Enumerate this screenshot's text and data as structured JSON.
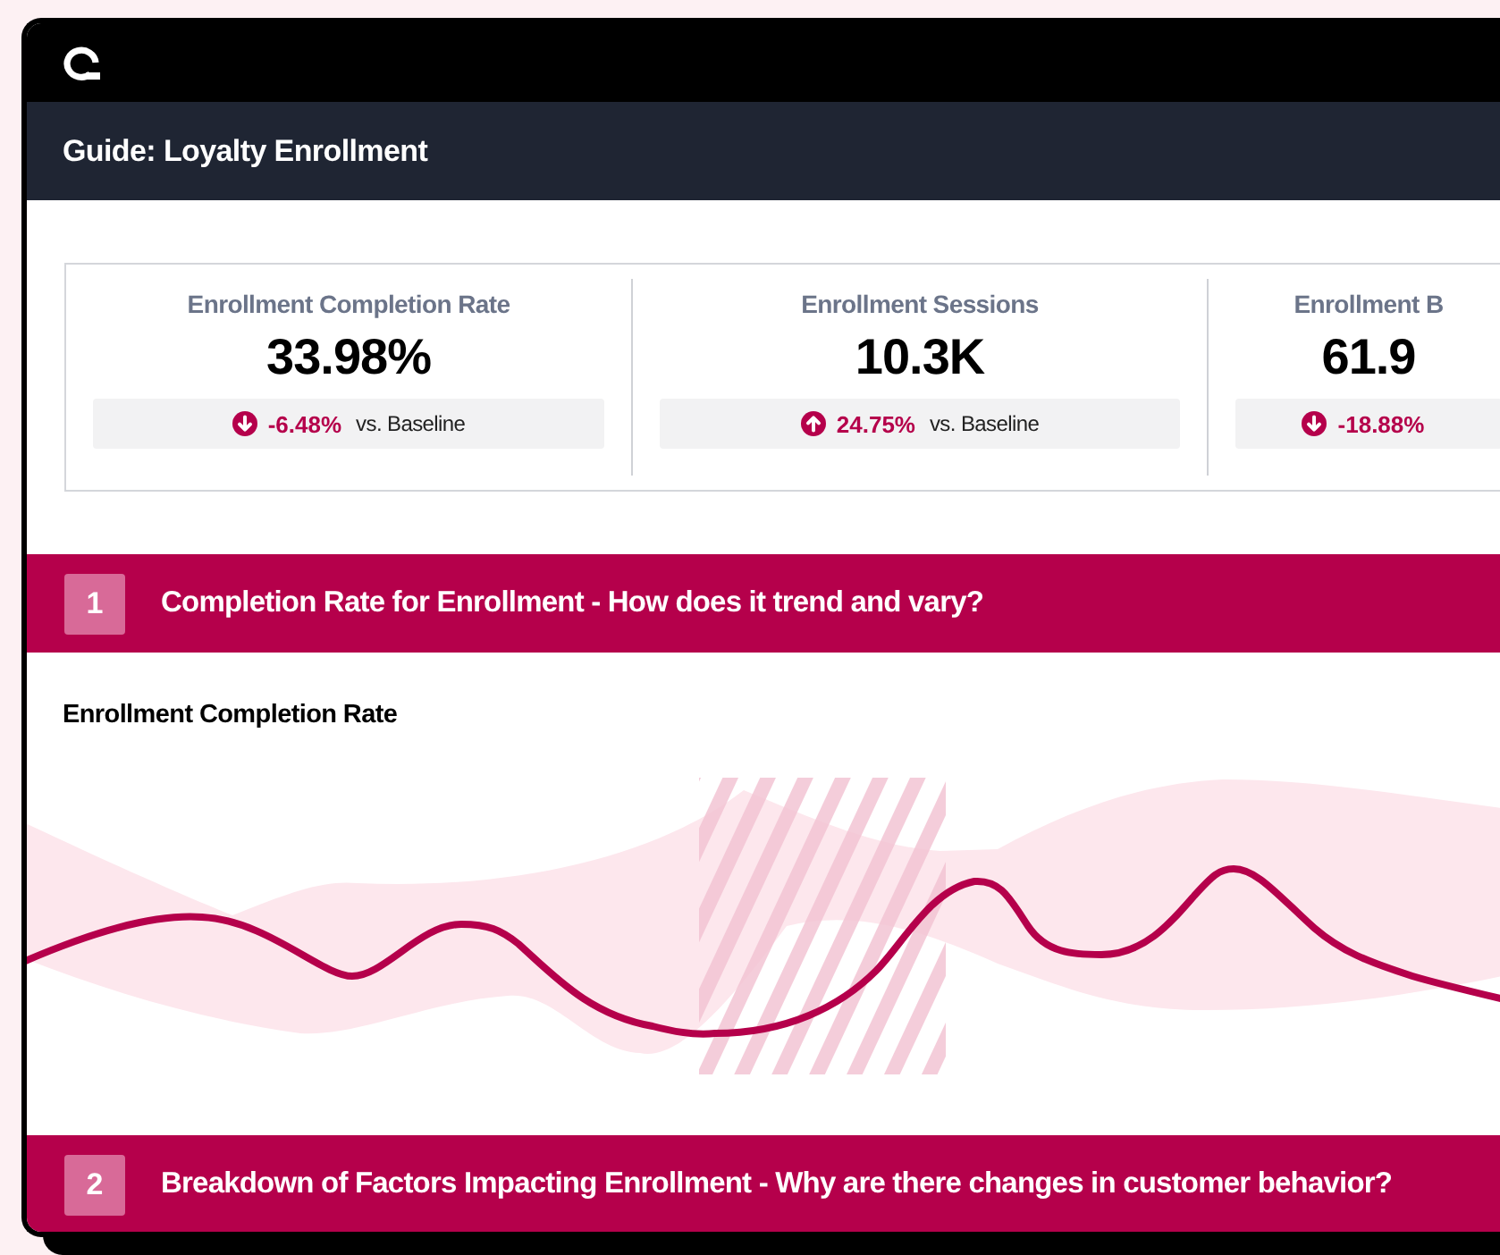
{
  "app": {
    "title": "Guide: Loyalty Enrollment"
  },
  "metrics": [
    {
      "label": "Enrollment Completion Rate",
      "value": "33.98%",
      "kind": "decrease",
      "change": "-6.48%",
      "comparison": "vs. Baseline"
    },
    {
      "label": "Enrollment Sessions",
      "value": "10.3K",
      "kind": "increase",
      "change": "24.75%",
      "comparison": "vs. Baseline"
    },
    {
      "label": "Enrollment B",
      "value": "61.9",
      "kind": "decrease",
      "change": "-18.88%"
    }
  ],
  "sections": [
    {
      "number": "1",
      "title": "Completion Rate for Enrollment - How does it trend and vary?",
      "chart": {
        "title": "Enrollment Completion Rate"
      }
    },
    {
      "number": "2",
      "title": "Breakdown of Factors Impacting Enrollment - Why are there changes in customer behavior?"
    }
  ]
}
